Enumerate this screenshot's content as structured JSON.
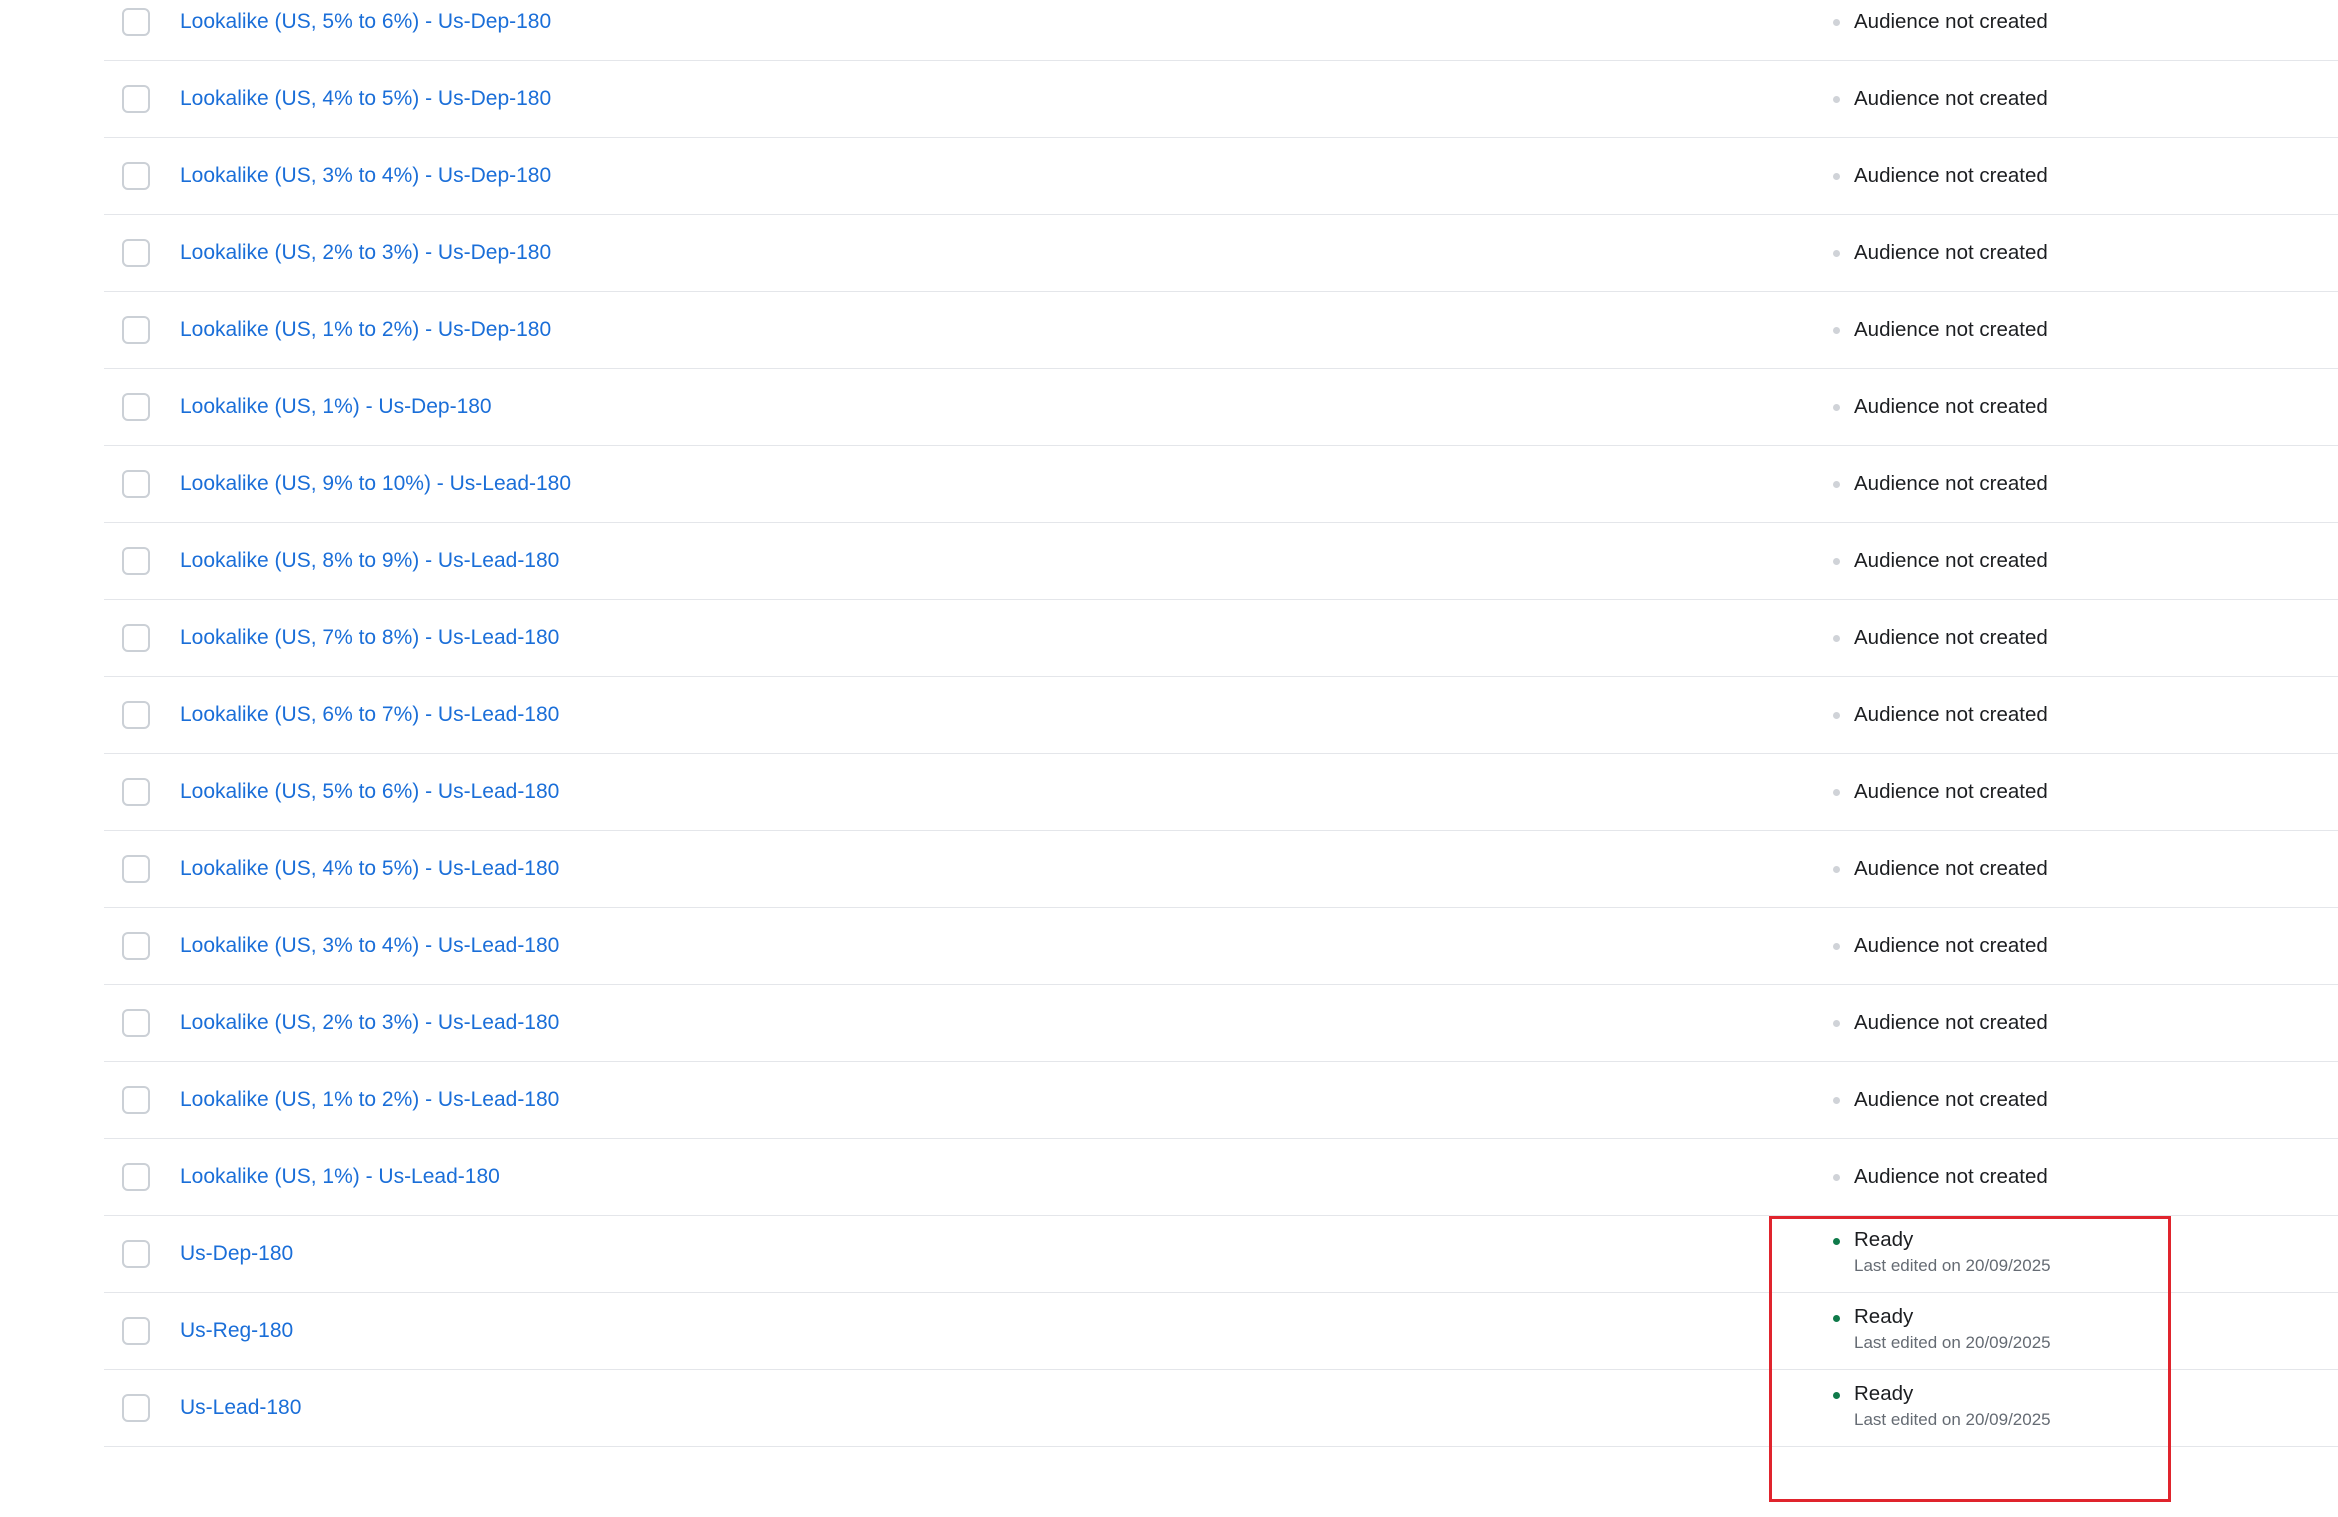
{
  "rows": [
    {
      "name": "Lookalike (US, 5% to 6%) - Us-Dep-180",
      "status": "Audience not created"
    },
    {
      "name": "Lookalike (US, 4% to 5%) - Us-Dep-180",
      "status": "Audience not created"
    },
    {
      "name": "Lookalike (US, 3% to 4%) - Us-Dep-180",
      "status": "Audience not created"
    },
    {
      "name": "Lookalike (US, 2% to 3%) - Us-Dep-180",
      "status": "Audience not created"
    },
    {
      "name": "Lookalike (US, 1% to 2%) - Us-Dep-180",
      "status": "Audience not created"
    },
    {
      "name": "Lookalike (US, 1%) - Us-Dep-180",
      "status": "Audience not created"
    },
    {
      "name": "Lookalike (US, 9% to 10%) - Us-Lead-180",
      "status": "Audience not created"
    },
    {
      "name": "Lookalike (US, 8% to 9%) - Us-Lead-180",
      "status": "Audience not created"
    },
    {
      "name": "Lookalike (US, 7% to 8%) - Us-Lead-180",
      "status": "Audience not created"
    },
    {
      "name": "Lookalike (US, 6% to 7%) - Us-Lead-180",
      "status": "Audience not created"
    },
    {
      "name": "Lookalike (US, 5% to 6%) - Us-Lead-180",
      "status": "Audience not created"
    },
    {
      "name": "Lookalike (US, 4% to 5%) - Us-Lead-180",
      "status": "Audience not created"
    },
    {
      "name": "Lookalike (US, 3% to 4%) - Us-Lead-180",
      "status": "Audience not created"
    },
    {
      "name": "Lookalike (US, 2% to 3%) - Us-Lead-180",
      "status": "Audience not created"
    },
    {
      "name": "Lookalike (US, 1% to 2%) - Us-Lead-180",
      "status": "Audience not created"
    },
    {
      "name": "Lookalike (US, 1%) - Us-Lead-180",
      "status": "Audience not created"
    },
    {
      "name": "Us-Dep-180",
      "status": "Ready",
      "status_detail": "Last edited on 20/09/2025"
    },
    {
      "name": "Us-Reg-180",
      "status": "Ready",
      "status_detail": "Last edited on 20/09/2025"
    },
    {
      "name": "Us-Lead-180",
      "status": "Ready",
      "status_detail": "Last edited on 20/09/2025"
    }
  ],
  "colors": {
    "link": "#1a6ed8",
    "ready_dot": "#0f7a4a",
    "inactive_dot": "#d0d3d8",
    "highlight": "#e0242d"
  }
}
